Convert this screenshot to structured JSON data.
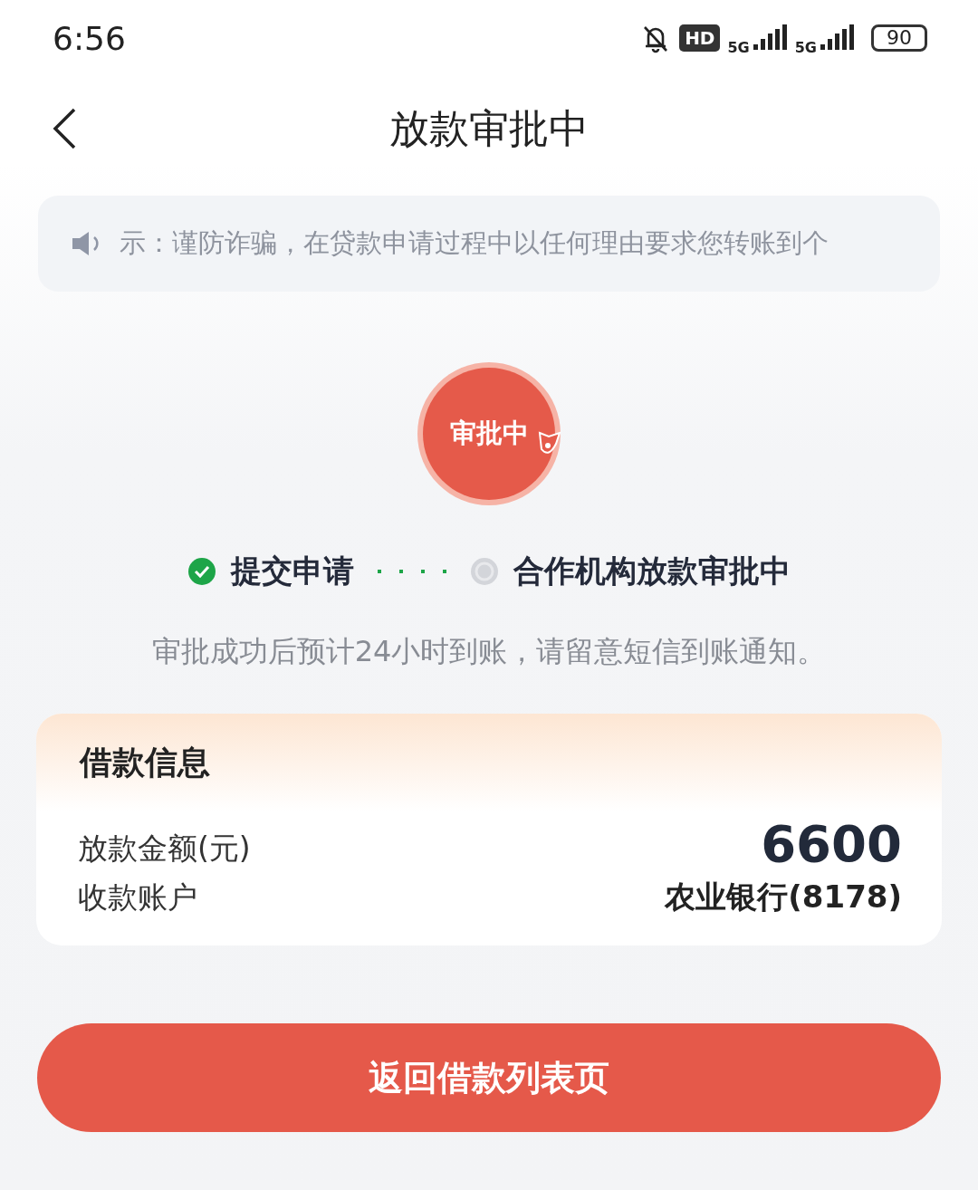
{
  "status_bar": {
    "time": "6:56",
    "hd_badge": "HD",
    "network_1": "5G",
    "network_2": "5G",
    "battery": "90"
  },
  "header": {
    "title": "放款审批中"
  },
  "notice": {
    "text": "示：谨防诈骗，在贷款申请过程中以任何理由要求您转账到个"
  },
  "status_badge": {
    "label": "审批中"
  },
  "steps": [
    {
      "label": "提交申请",
      "done": true
    },
    {
      "label": "合作机构放款审批中",
      "done": false
    }
  ],
  "hint": "审批成功后预计24小时到账，请留意短信到账通知。",
  "loan_card": {
    "title": "借款信息",
    "rows": [
      {
        "label": "放款金额(元)",
        "value": "6600",
        "kind": "amount"
      },
      {
        "label": "收款账户",
        "value": "农业银行(8178)",
        "kind": "account"
      }
    ]
  },
  "primary_button": {
    "label": "返回借款列表页"
  }
}
